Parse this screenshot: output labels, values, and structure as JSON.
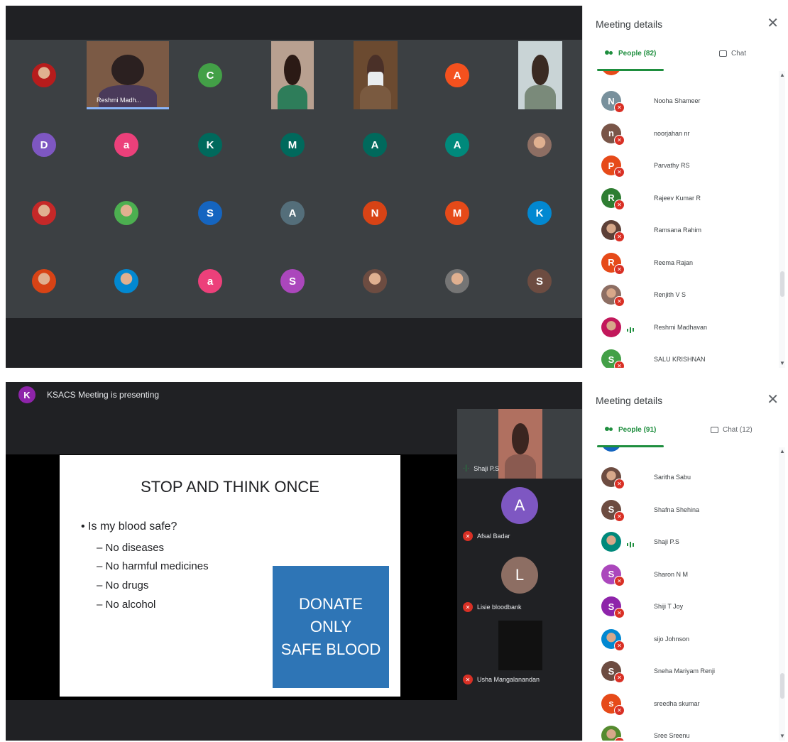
{
  "meeting1": {
    "panel_title": "Meeting details",
    "people_tab": "People (82)",
    "chat_tab": "Chat",
    "video_name": "Reshmi Madh...",
    "grid": [
      {
        "letter": "",
        "color": "#b71c1c",
        "photo": true
      },
      {
        "letter": "C",
        "color": "#43a047"
      },
      {
        "letter": "A",
        "color": "#f4511e"
      },
      {
        "letter": "D",
        "color": "#7e57c2"
      },
      {
        "letter": "a",
        "color": "#ec407a"
      },
      {
        "letter": "K",
        "color": "#00695c"
      },
      {
        "letter": "M",
        "color": "#00695c"
      },
      {
        "letter": "A",
        "color": "#00695c"
      },
      {
        "letter": "A",
        "color": "#00897b"
      },
      {
        "letter": "",
        "color": "#8d6e63",
        "photo": true
      },
      {
        "letter": "",
        "color": "#c62828",
        "photo": true
      },
      {
        "letter": "",
        "color": "#4caf50",
        "photo": true
      },
      {
        "letter": "S",
        "color": "#1565c0"
      },
      {
        "letter": "A",
        "color": "#546e7a"
      },
      {
        "letter": "N",
        "color": "#d84315"
      },
      {
        "letter": "M",
        "color": "#e64a19"
      },
      {
        "letter": "K",
        "color": "#0288d1"
      },
      {
        "letter": "",
        "color": "#d84315",
        "photo": true
      },
      {
        "letter": "",
        "color": "#0288d1",
        "photo": true
      },
      {
        "letter": "a",
        "color": "#ec407a"
      },
      {
        "letter": "S",
        "color": "#ab47bc"
      },
      {
        "letter": "",
        "color": "#6d4c41",
        "photo": true
      },
      {
        "letter": "",
        "color": "#757575",
        "photo": true
      },
      {
        "letter": "S",
        "color": "#6d4c41"
      }
    ],
    "people": [
      {
        "initial": "N",
        "name": "Nooha Shameer",
        "color": "#78909c",
        "muted": true
      },
      {
        "initial": "n",
        "name": "noorjahan nr",
        "color": "#795548",
        "muted": true
      },
      {
        "initial": "P",
        "name": "Parvathy RS",
        "color": "#e64a19",
        "muted": true
      },
      {
        "initial": "R",
        "name": "Rajeev Kumar R",
        "color": "#2e7d32",
        "muted": true
      },
      {
        "initial": "",
        "name": "Ramsana Rahim",
        "color": "#5d4037",
        "muted": true
      },
      {
        "initial": "R",
        "name": "Reema Rajan",
        "color": "#e64a19",
        "muted": true
      },
      {
        "initial": "",
        "name": "Renjith V S",
        "color": "#8d6e63",
        "muted": true
      },
      {
        "initial": "",
        "name": "Reshmi Madhavan",
        "color": "#c2185b",
        "muted": false
      },
      {
        "initial": "S",
        "name": "SALU KRISHNAN",
        "color": "#43a047",
        "muted": true
      }
    ]
  },
  "meeting2": {
    "presenter_initial": "K",
    "presenting_text": "KSACS Meeting is presenting",
    "panel_title": "Meeting details",
    "people_tab": "People (91)",
    "chat_tab": "Chat (12)",
    "slide": {
      "title": "STOP AND THINK ONCE",
      "bullet": "Is my blood safe?",
      "subs": [
        "– No diseases",
        "– No harmful medicines",
        "– No drugs",
        "– No alcohol"
      ],
      "box_lines": [
        "DONATE",
        "ONLY",
        "SAFE BLOOD"
      ]
    },
    "strip": [
      {
        "name": "Shaji P.S",
        "initial": "",
        "color": "#8d6e63"
      },
      {
        "name": "Afsal Badar",
        "initial": "A",
        "color": "#7e57c2"
      },
      {
        "name": "Lisie bloodbank",
        "initial": "L",
        "color": "#8d6e63"
      },
      {
        "name": "Usha Mangalanandan",
        "initial": "",
        "color": "#111111"
      }
    ],
    "people": [
      {
        "initial": "",
        "name": "Saritha Sabu",
        "color": "#6d4c41",
        "muted": true
      },
      {
        "initial": "S",
        "name": "Shafna Shehina",
        "color": "#6d4c41",
        "muted": true
      },
      {
        "initial": "",
        "name": "Shaji P.S",
        "color": "#00897b",
        "muted": false
      },
      {
        "initial": "S",
        "name": "Sharon N M",
        "color": "#ab47bc",
        "muted": true
      },
      {
        "initial": "S",
        "name": "Shiji T Joy",
        "color": "#8e24aa",
        "muted": true
      },
      {
        "initial": "",
        "name": "sijo Johnson",
        "color": "#0288d1",
        "muted": true
      },
      {
        "initial": "S",
        "name": "Sneha Mariyam Renji",
        "color": "#6d4c41",
        "muted": true
      },
      {
        "initial": "s",
        "name": "sreedha skumar",
        "color": "#e64a19",
        "muted": true
      },
      {
        "initial": "",
        "name": "Sree Sreenu",
        "color": "#558b2f",
        "muted": true
      }
    ]
  }
}
